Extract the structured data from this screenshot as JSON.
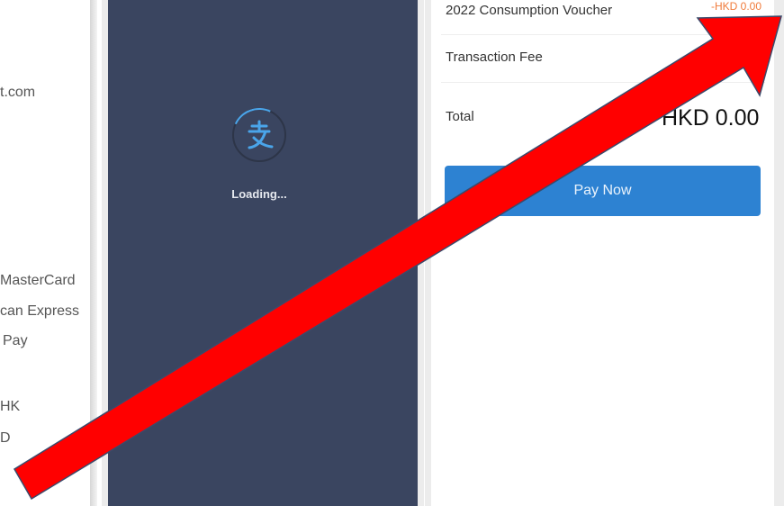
{
  "left_panel": {
    "fragments": [
      "t.com",
      "MasterCard",
      "can Express",
      "Pay",
      "HK",
      "D"
    ]
  },
  "loading_screen": {
    "icon": "alipay-icon",
    "loading_text": "Loading..."
  },
  "payment": {
    "rows": [
      {
        "label": "2022 Consumption Voucher",
        "value": "-HKD 0.00"
      },
      {
        "label": "Transaction Fee"
      },
      {
        "label": "Total",
        "value": "HKD 0.00"
      }
    ],
    "pay_button_label": "Pay Now"
  },
  "annotation": {
    "type": "arrow",
    "color": "#ff0000",
    "outline": "#3b4a6b"
  }
}
